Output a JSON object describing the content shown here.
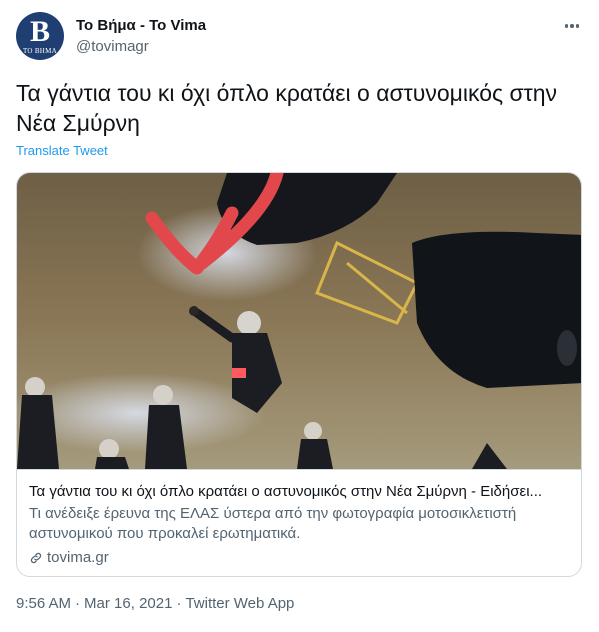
{
  "account": {
    "display_name": "Το Βήμα - To Vima",
    "handle": "@tovimagr",
    "avatar_letter": "B",
    "avatar_sub": "TO ΒΗΜΑ"
  },
  "tweet": {
    "text": "Τα γάντια του κι όχι όπλο κρατάει ο αστυνομικός στην Νέα Σμύρνη",
    "translate_label": "Translate Tweet"
  },
  "card": {
    "title": "Τα γάντια του κι όχι όπλο κρατάει ο αστυνομικός στην Νέα Σμύρνη - Ειδήσει...",
    "description": "Τι ανέδειξε έρευνα της ΕΛΑΣ ύστερα από την φωτογραφία μοτοσικλετιστή αστυνομικού που προκαλεί ερωτηματικά.",
    "domain": "tovima.gr"
  },
  "meta": {
    "time": "9:56 AM",
    "separator1": "·",
    "date": "Mar 16, 2021",
    "separator2": "·",
    "app": "Twitter Web App"
  },
  "colors": {
    "link": "#1d9bf0",
    "secondary_text": "#536471",
    "border": "#cfd9de",
    "avatar_bg": "#1f3f73"
  },
  "icons": {
    "more": "more-horizontal-icon",
    "link": "link-icon"
  }
}
